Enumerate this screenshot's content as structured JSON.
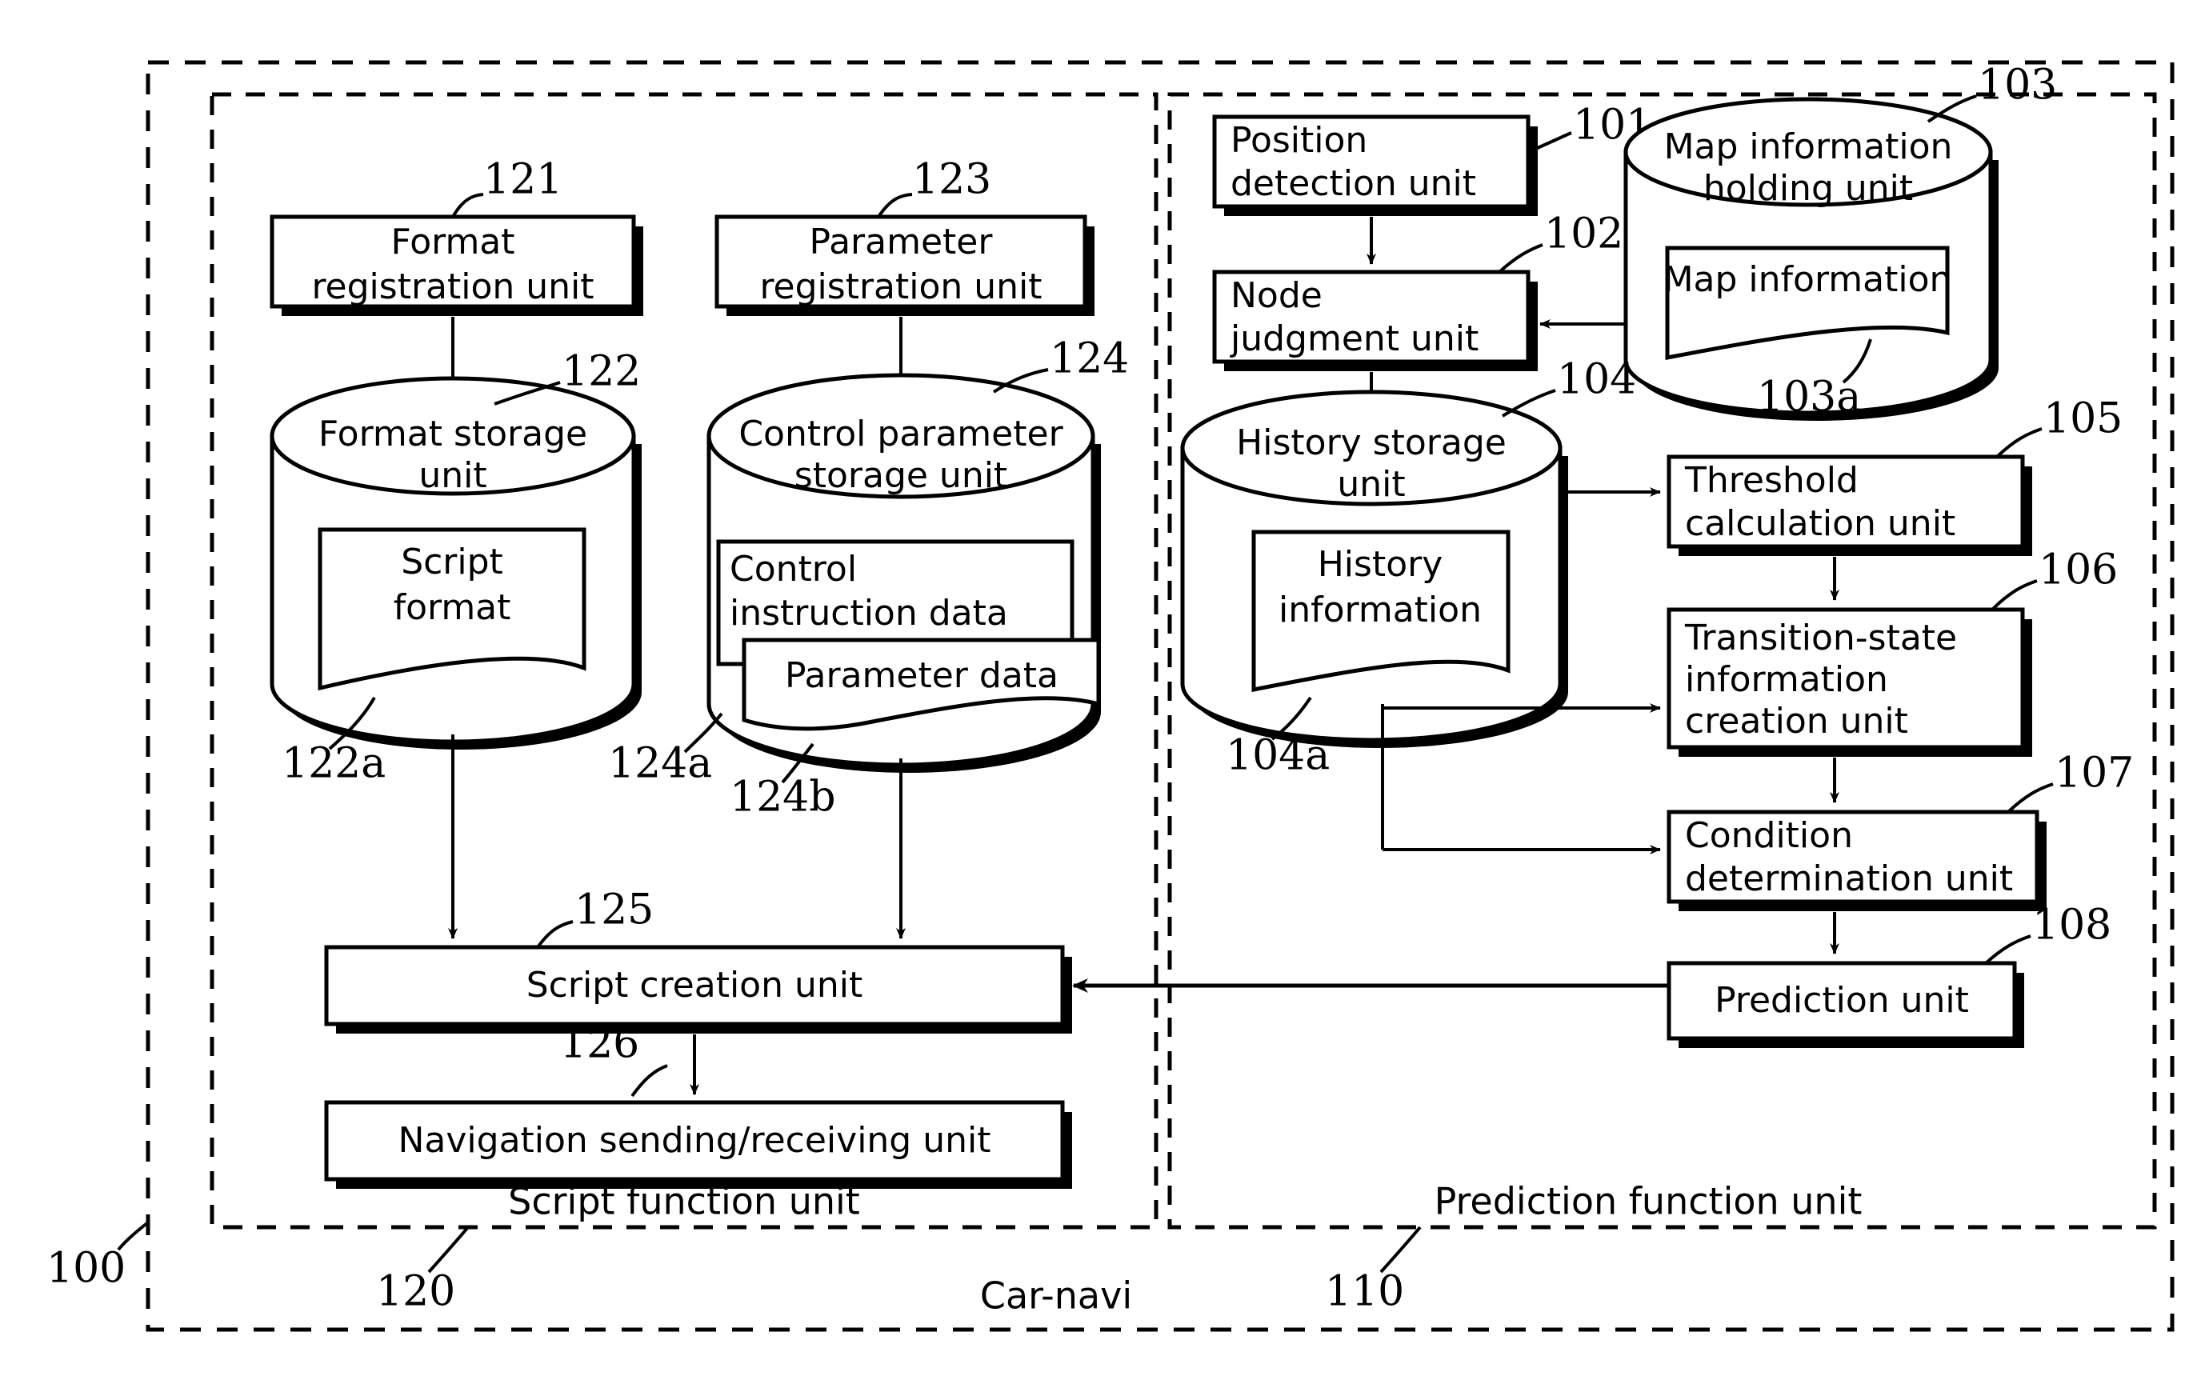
{
  "figure": {
    "type": "patent-block-diagram",
    "outer_region": {
      "label": "Car-navi",
      "ref": "100"
    },
    "regions": [
      {
        "id": "script-function-unit",
        "label": "Script function unit",
        "ref": "120"
      },
      {
        "id": "prediction-function-unit",
        "label": "Prediction function unit",
        "ref": "110"
      }
    ],
    "blocks": [
      {
        "id": "format-registration-unit",
        "label": "Format registration unit",
        "ref": "121",
        "shape": "box"
      },
      {
        "id": "parameter-registration-unit",
        "label": "Parameter registration unit",
        "ref": "123",
        "shape": "box"
      },
      {
        "id": "format-storage-unit",
        "label": "Format storage unit",
        "ref": "122",
        "shape": "cylinder"
      },
      {
        "id": "script-format",
        "label": "Script format",
        "ref": "122a",
        "shape": "inner-box"
      },
      {
        "id": "control-parameter-storage-unit",
        "label": "Control parameter storage unit",
        "ref": "124",
        "shape": "cylinder"
      },
      {
        "id": "control-instruction-data",
        "label": "Control instruction data",
        "ref": "124a",
        "shape": "inner-box"
      },
      {
        "id": "parameter-data",
        "label": "Parameter data",
        "ref": "124b",
        "shape": "inner-box"
      },
      {
        "id": "script-creation-unit",
        "label": "Script creation unit",
        "ref": "125",
        "shape": "box"
      },
      {
        "id": "navigation-sending-receiving-unit",
        "label": "Navigation sending/receiving unit",
        "ref": "126",
        "shape": "box"
      },
      {
        "id": "position-detection-unit",
        "label": "Position detection unit",
        "ref": "101",
        "shape": "box"
      },
      {
        "id": "node-judgment-unit",
        "label": "Node judgment unit",
        "ref": "102",
        "shape": "box"
      },
      {
        "id": "map-information-holding-unit",
        "label": "Map information holding unit",
        "ref": "103",
        "shape": "cylinder"
      },
      {
        "id": "map-information",
        "label": "Map information",
        "ref": "103a",
        "shape": "inner-box"
      },
      {
        "id": "history-storage-unit",
        "label": "History storage unit",
        "ref": "104",
        "shape": "cylinder"
      },
      {
        "id": "history-information",
        "label": "History information",
        "ref": "104a",
        "shape": "inner-box"
      },
      {
        "id": "threshold-calculation-unit",
        "label": "Threshold calculation unit",
        "ref": "105",
        "shape": "box"
      },
      {
        "id": "transition-state-information-creation-unit",
        "label": "Transition-state information creation unit",
        "ref": "106",
        "shape": "box"
      },
      {
        "id": "condition-determination-unit",
        "label": "Condition determination unit",
        "ref": "107",
        "shape": "box"
      },
      {
        "id": "prediction-unit",
        "label": "Prediction unit",
        "ref": "108",
        "shape": "box"
      }
    ]
  },
  "labels": {
    "format_registration_line1": "Format",
    "format_registration_line2": "registration unit",
    "parameter_registration_line1": "Parameter",
    "parameter_registration_line2": "registration unit",
    "format_storage_line1": "Format storage",
    "format_storage_line2": "unit",
    "script_format_line1": "Script",
    "script_format_line2": "format",
    "control_param_storage_line1": "Control parameter",
    "control_param_storage_line2": "storage unit",
    "control_instruction_line1": "Control",
    "control_instruction_line2": "instruction data",
    "parameter_data": "Parameter data",
    "script_creation_unit": "Script creation unit",
    "navigation_unit": "Navigation sending/receiving unit",
    "position_detection_line1": "Position",
    "position_detection_line2": "detection unit",
    "node_judgment_line1": "Node",
    "node_judgment_line2": "judgment unit",
    "map_holding_line1": "Map information",
    "map_holding_line2": "holding unit",
    "map_information": "Map information",
    "history_storage_line1": "History storage",
    "history_storage_line2": "unit",
    "history_information_line1": "History",
    "history_information_line2": "information",
    "threshold_line1": "Threshold",
    "threshold_line2": "calculation unit",
    "transition_line1": "Transition-state",
    "transition_line2": "information",
    "transition_line3": "creation unit",
    "condition_line1": "Condition",
    "condition_line2": "determination unit",
    "prediction_unit": "Prediction unit",
    "script_function_unit": "Script function unit",
    "prediction_function_unit": "Prediction function unit",
    "car_navi": "Car-navi"
  },
  "refs": {
    "r100": "100",
    "r101": "101",
    "r102": "102",
    "r103": "103",
    "r103a": "103a",
    "r104": "104",
    "r104a": "104a",
    "r105": "105",
    "r106": "106",
    "r107": "107",
    "r108": "108",
    "r110": "110",
    "r120": "120",
    "r121": "121",
    "r122": "122",
    "r122a": "122a",
    "r123": "123",
    "r124": "124",
    "r124a": "124a",
    "r124b": "124b",
    "r125": "125",
    "r126": "126"
  },
  "colors": {
    "stroke": "#000000",
    "fill": "#ffffff"
  }
}
